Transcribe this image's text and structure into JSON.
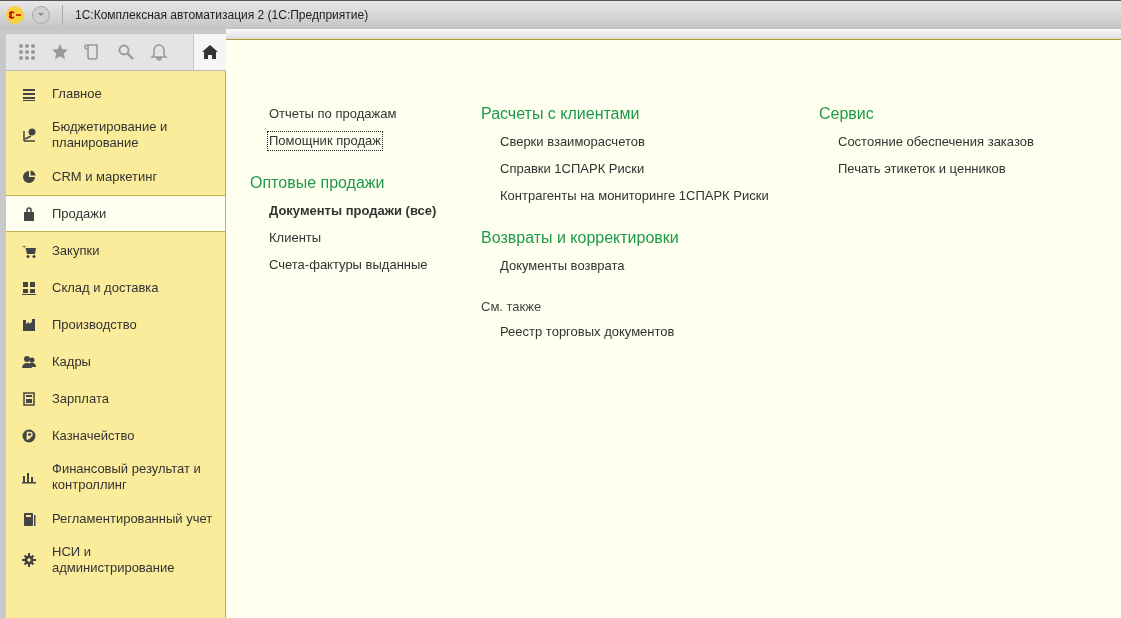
{
  "window": {
    "title": "1С:Комплексная автоматизация 2  (1С:Предприятие)"
  },
  "sidebar": {
    "items": [
      {
        "label": "Главное",
        "selected": false
      },
      {
        "label": "Бюджетирование и планирование",
        "selected": false
      },
      {
        "label": "CRM и маркетинг",
        "selected": false
      },
      {
        "label": "Продажи",
        "selected": true
      },
      {
        "label": "Закупки",
        "selected": false
      },
      {
        "label": "Склад и доставка",
        "selected": false
      },
      {
        "label": "Производство",
        "selected": false
      },
      {
        "label": "Кадры",
        "selected": false
      },
      {
        "label": "Зарплата",
        "selected": false
      },
      {
        "label": "Казначейство",
        "selected": false
      },
      {
        "label": "Финансовый результат и контроллинг",
        "selected": false
      },
      {
        "label": "Регламентированный учет",
        "selected": false
      },
      {
        "label": "НСИ и администрирование",
        "selected": false
      }
    ]
  },
  "content": {
    "columns": [
      {
        "blocks": [
          {
            "kind": "links",
            "items": [
              {
                "label": "Отчеты по продажам",
                "emphasized": false,
                "focused": false
              },
              {
                "label": "Помощник продаж",
                "emphasized": false,
                "focused": true
              }
            ]
          },
          {
            "kind": "group",
            "title": "Оптовые продажи",
            "items": [
              {
                "label": "Документы продажи (все)",
                "emphasized": true,
                "focused": false
              },
              {
                "label": "Клиенты",
                "emphasized": false,
                "focused": false
              },
              {
                "label": "Счета-фактуры выданные",
                "emphasized": false,
                "focused": false
              }
            ]
          }
        ]
      },
      {
        "blocks": [
          {
            "kind": "group",
            "title": "Расчеты с клиентами",
            "items": [
              {
                "label": "Сверки взаиморасчетов",
                "emphasized": false,
                "focused": false
              },
              {
                "label": "Справки 1СПАРК Риски",
                "emphasized": false,
                "focused": false
              },
              {
                "label": "Контрагенты на мониторинге 1СПАРК Риски",
                "emphasized": false,
                "focused": false
              }
            ]
          },
          {
            "kind": "group",
            "title": "Возвраты и корректировки",
            "items": [
              {
                "label": "Документы возврата",
                "emphasized": false,
                "focused": false
              }
            ]
          },
          {
            "kind": "see_also",
            "title": "См. также",
            "items": [
              {
                "label": "Реестр торговых документов",
                "emphasized": false,
                "focused": false
              }
            ]
          }
        ]
      },
      {
        "blocks": [
          {
            "kind": "group",
            "title": "Сервис",
            "items": [
              {
                "label": "Состояние обеспечения заказов",
                "emphasized": false,
                "focused": false
              },
              {
                "label": "Печать этикеток и ценников",
                "emphasized": false,
                "focused": false
              }
            ]
          }
        ]
      }
    ]
  }
}
